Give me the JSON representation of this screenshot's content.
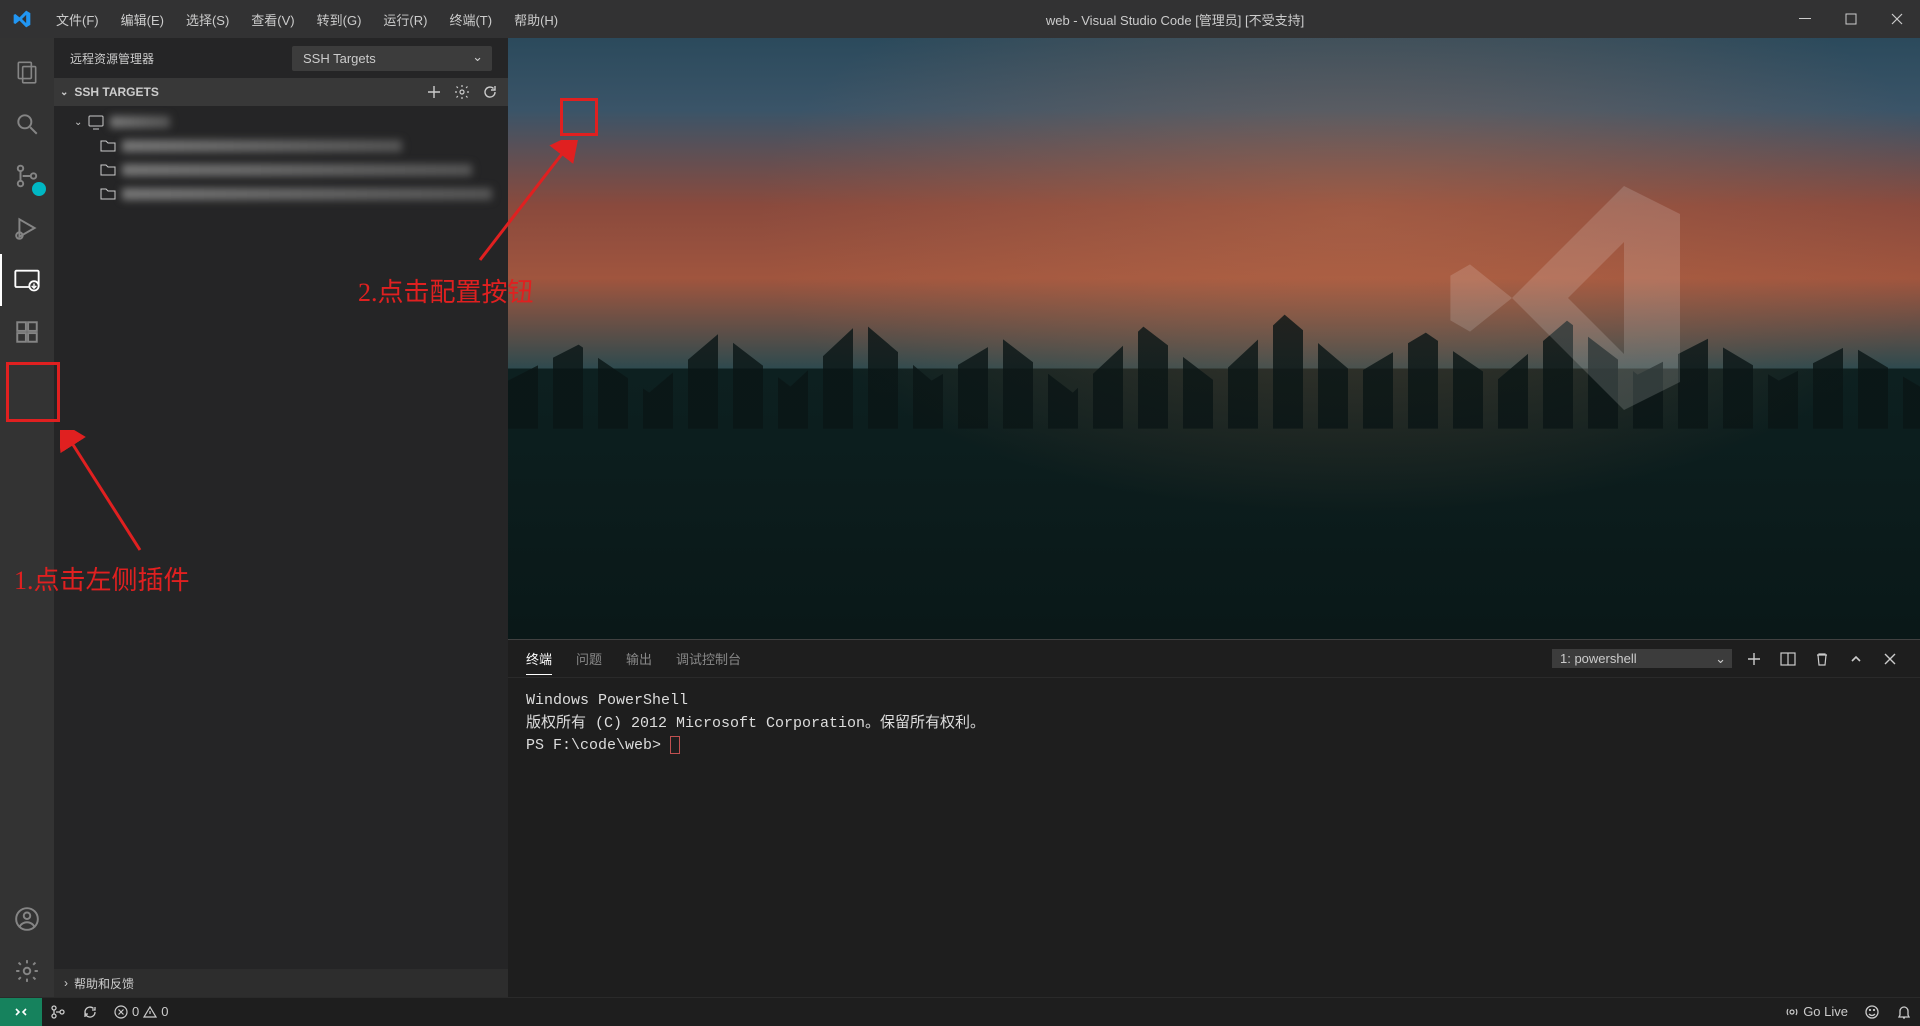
{
  "titlebar": {
    "menu": [
      "文件(F)",
      "编辑(E)",
      "选择(S)",
      "查看(V)",
      "转到(G)",
      "运行(R)",
      "终端(T)",
      "帮助(H)"
    ],
    "title": "web - Visual Studio Code [管理员] [不受支持]"
  },
  "sidebar": {
    "title": "远程资源管理器",
    "dropdown": "SSH Targets",
    "section": "SSH TARGETS",
    "help": "帮助和反馈"
  },
  "panel": {
    "tabs": [
      "终端",
      "问题",
      "输出",
      "调试控制台"
    ],
    "active_tab": "终端",
    "selector": "1: powershell",
    "lines": [
      "Windows PowerShell",
      "版权所有 (C) 2012 Microsoft Corporation。保留所有权利。",
      "",
      "PS F:\\code\\web> "
    ]
  },
  "statusbar": {
    "errors": "0",
    "warnings": "0",
    "golive": "Go Live"
  },
  "annotations": {
    "step1": "1.点击左侧插件",
    "step2": "2.点击配置按钮"
  }
}
